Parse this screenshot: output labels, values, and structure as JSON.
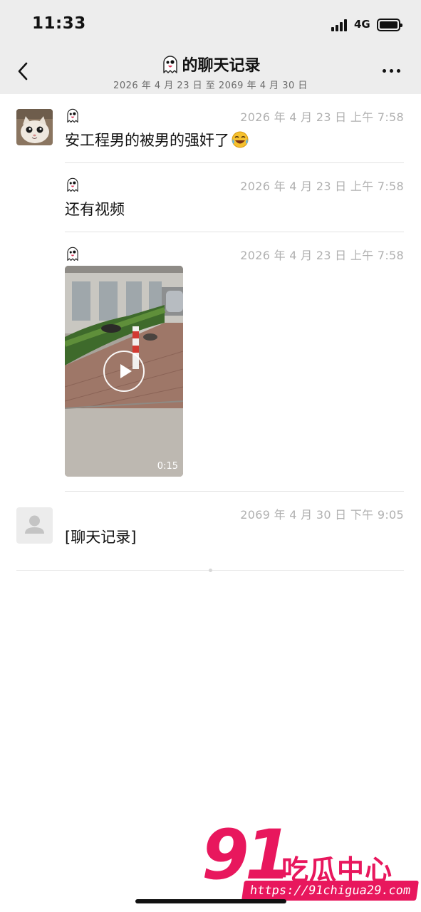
{
  "status_bar": {
    "time": "11:33",
    "network": "4G"
  },
  "header": {
    "title": "的聊天记录",
    "subtitle": "2026 年 4 月 23 日 至 2069 年 4 月 30 日"
  },
  "messages": [
    {
      "timestamp": "2026 年 4 月 23 日 上午 7:58",
      "text": "安工程男的被男的强奸了",
      "emoji": "laughing-crying-emoji"
    },
    {
      "timestamp": "2026 年 4 月 23 日 上午 7:58",
      "text": "还有视频"
    },
    {
      "timestamp": "2026 年 4 月 23 日 上午 7:58",
      "video_duration": "0:15"
    },
    {
      "timestamp": "2069 年 4 月 30 日 下午 9:05",
      "text": "[聊天记录]"
    }
  ],
  "watermark": {
    "number": "91",
    "brand": "吃瓜中心",
    "url": "https://91chigua29.com"
  },
  "colors": {
    "bar_bg": "#ededed",
    "meta_gray": "#b0b0b0",
    "watermark_pink": "#e8175d"
  }
}
